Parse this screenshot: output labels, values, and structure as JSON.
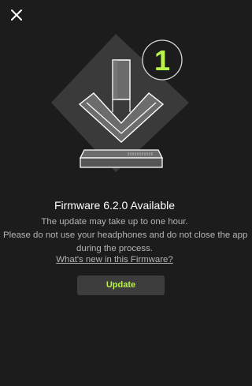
{
  "header": {
    "close_icon": "close-icon"
  },
  "hero": {
    "badge_number": "1"
  },
  "content": {
    "title": "Firmware 6.2.0 Available",
    "line1": "The update may take up to one hour.",
    "line2": "Please do not use your headphones and do not close the app",
    "line3": "during the process.",
    "link": "What's new in this Firmware?",
    "button": "Update"
  },
  "colors": {
    "background": "#1c1c1c",
    "accent": "#b8f24a",
    "button_bg": "#3d3d3d",
    "text_secondary": "#b5b5b5"
  }
}
